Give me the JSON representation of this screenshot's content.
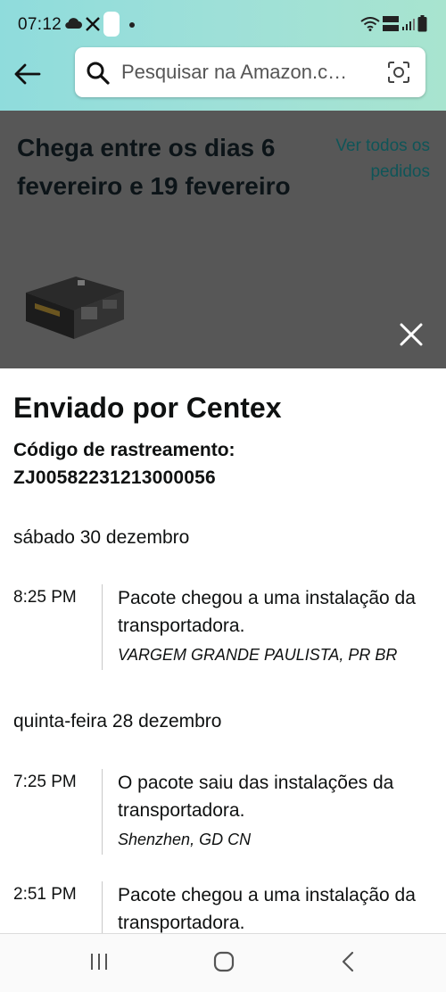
{
  "status_bar": {
    "time": "07:12",
    "network_label": "VoLTE1"
  },
  "search": {
    "placeholder": "Pesquisar na Amazon.c…"
  },
  "order": {
    "arrival_text": "Chega entre os dias 6 fevereiro e 19 fevereiro",
    "view_all_orders": "Ver todos os pedidos"
  },
  "tracking": {
    "title": "Enviado por Centex",
    "code_label": "Código de rastreamento:",
    "code": "ZJ00582231213000056",
    "days": [
      {
        "date": "sábado 30 dezembro",
        "events": [
          {
            "time": "8:25 PM",
            "description": "Pacote chegou a uma instalação da transportadora.",
            "location": "VARGEM GRANDE PAULISTA, PR BR"
          }
        ]
      },
      {
        "date": "quinta-feira 28 dezembro",
        "events": [
          {
            "time": "7:25 PM",
            "description": "O pacote saiu das instalações da transportadora.",
            "location": "Shenzhen, GD CN"
          },
          {
            "time": "2:51 PM",
            "description": "Pacote chegou a uma instalação da transportadora.",
            "location": ""
          }
        ]
      }
    ]
  },
  "colors": {
    "header_accent": "#a0e1d6",
    "link": "#0f5558",
    "overlay": "#575757"
  }
}
